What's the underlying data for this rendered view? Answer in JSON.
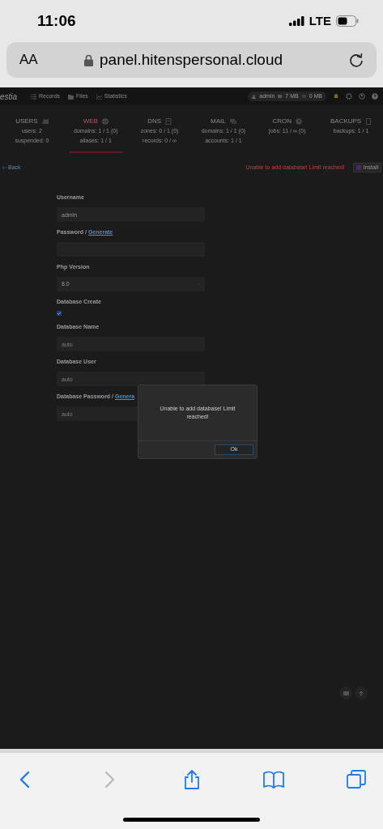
{
  "phone_status": {
    "time": "11:06",
    "network": "LTE"
  },
  "address_bar": {
    "text_size_button": "AA",
    "url": "panel.hitenspersonal.cloud"
  },
  "nav": {
    "logo": "estia",
    "items": [
      "Records",
      "Files",
      "Statistics"
    ],
    "user": "admin",
    "disk": "7 MB",
    "bandwidth": "0 MB"
  },
  "stats": [
    {
      "title": "USERS",
      "selected": false,
      "lines": [
        "users: 2",
        "suspended: 0"
      ]
    },
    {
      "title": "WEB",
      "selected": true,
      "lines": [
        "domains: 1 / 1 (0)",
        "aliases: 1 / 1"
      ]
    },
    {
      "title": "DNS",
      "selected": false,
      "lines": [
        "zones: 0 / 1 (0)",
        "records: 0 / ∞"
      ]
    },
    {
      "title": "MAIL",
      "selected": false,
      "lines": [
        "domains: 1 / 1 (0)",
        "accounts: 1 / 1"
      ]
    },
    {
      "title": "CRON",
      "selected": false,
      "lines": [
        "jobs: 11 / ∞ (0)"
      ]
    },
    {
      "title": "BACKUPS",
      "selected": false,
      "lines": [
        "backups: 1 / 1"
      ]
    }
  ],
  "toolbar": {
    "back": "Back",
    "error": "Unable to add database! Limit reached!",
    "install": "Install"
  },
  "form": [
    {
      "kind": "text",
      "label": "Username",
      "value": "admin"
    },
    {
      "kind": "text",
      "label": "Password / ",
      "link": "Generate"
    },
    {
      "kind": "select",
      "label": "Php Version",
      "value": "8.0"
    },
    {
      "kind": "checkbox",
      "label": "Database Create",
      "checked": true
    },
    {
      "kind": "text",
      "label": "Database Name",
      "placeholder": "auto"
    },
    {
      "kind": "text",
      "label": "Database User",
      "placeholder": "auto"
    },
    {
      "kind": "text",
      "label": "Database Password / ",
      "link": "Genera",
      "placeholder": "auto"
    }
  ],
  "dialog": {
    "message": "Unable to add database! Limit reached!",
    "button": "Ok"
  },
  "browser_toolbar": [
    {
      "kind": "back",
      "disabled": false
    },
    {
      "kind": "forward",
      "disabled": true
    },
    {
      "kind": "share",
      "disabled": false
    },
    {
      "kind": "bookmarks",
      "disabled": false
    },
    {
      "kind": "tabs",
      "disabled": false
    }
  ]
}
